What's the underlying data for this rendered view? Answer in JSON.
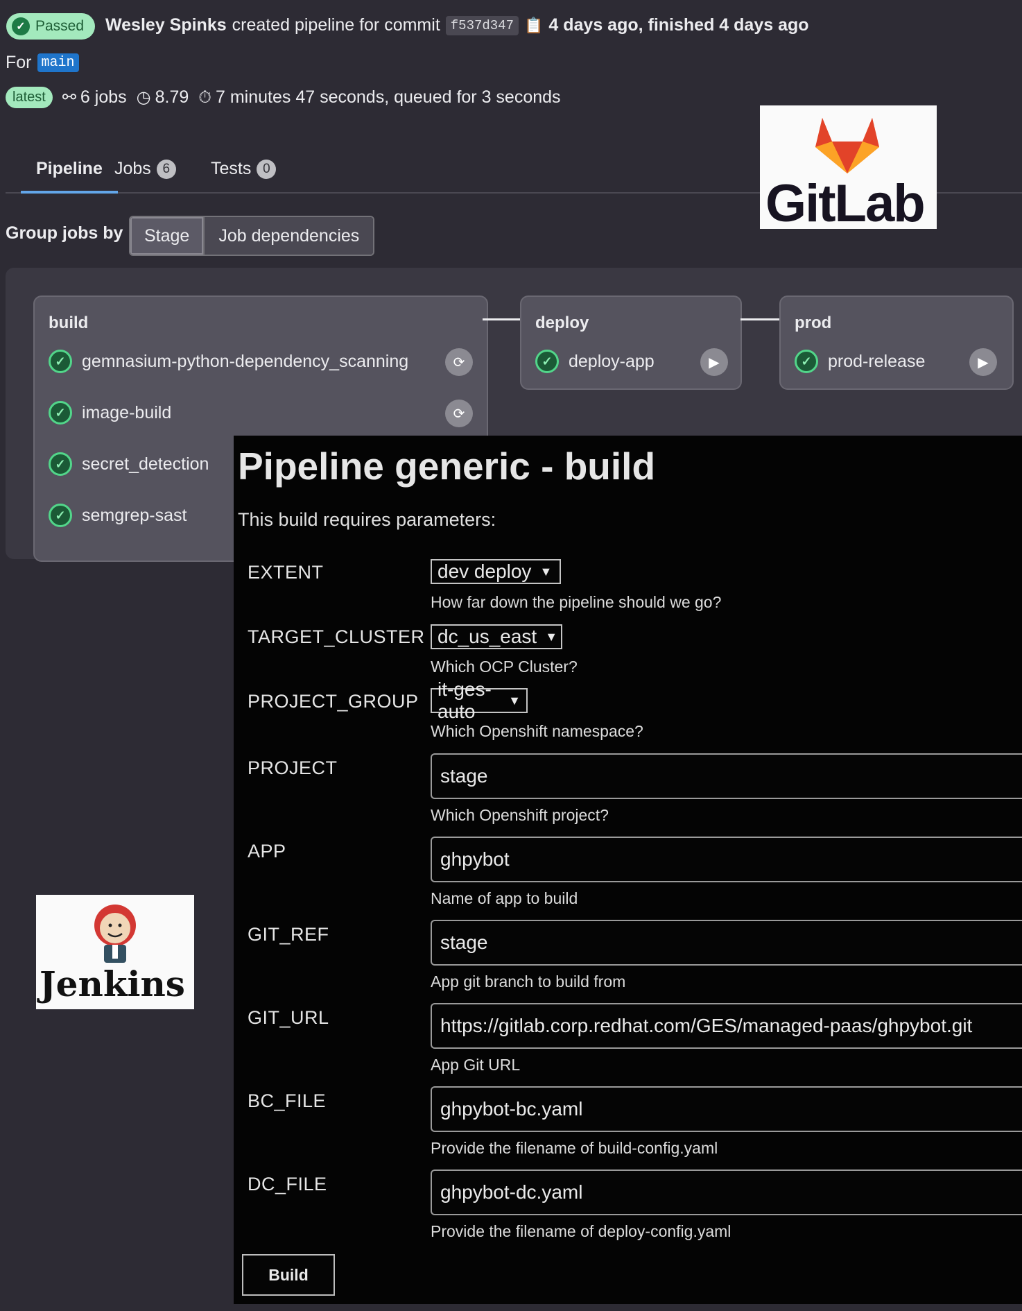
{
  "gitlab": {
    "status": "Passed",
    "author": "Wesley Spinks",
    "action_text": "created pipeline for commit",
    "commit_sha": "f537d347",
    "timing": "4 days ago, finished 4 days ago",
    "for_label": "For",
    "branch": "main",
    "latest_badge": "latest",
    "jobs_count": "6 jobs",
    "compute": "8.79",
    "duration": "7 minutes 47 seconds, queued for 3 seconds",
    "tabs": [
      {
        "label": "Pipeline",
        "count": ""
      },
      {
        "label": "Jobs",
        "count": "6"
      },
      {
        "label": "Tests",
        "count": "0"
      }
    ],
    "group_by_label": "Group jobs by",
    "group_by_options": [
      "Stage",
      "Job dependencies"
    ],
    "stages": [
      {
        "name": "build",
        "jobs": [
          "gemnasium-python-dependency_scanning",
          "image-build",
          "secret_detection",
          "semgrep-sast"
        ]
      },
      {
        "name": "deploy",
        "jobs": [
          "deploy-app"
        ]
      },
      {
        "name": "prod",
        "jobs": [
          "prod-release"
        ]
      }
    ],
    "logo_text": "GitLab",
    "logo_color": "#fc6d26"
  },
  "jenkins": {
    "logo_text": "Jenkins",
    "title": "Pipeline generic - build",
    "subtitle": "This build requires parameters:",
    "params": [
      {
        "name": "EXTENT",
        "value": "dev deploy",
        "desc": "How far down the pipeline should we go?"
      },
      {
        "name": "TARGET_CLUSTER",
        "value": "dc_us_east",
        "desc": "Which OCP Cluster?"
      },
      {
        "name": "PROJECT_GROUP",
        "value": "it-ges-auto",
        "desc": "Which Openshift namespace?"
      },
      {
        "name": "PROJECT",
        "value": "stage",
        "desc": "Which Openshift project?"
      },
      {
        "name": "APP",
        "value": "ghpybot",
        "desc": "Name of app to build"
      },
      {
        "name": "GIT_REF",
        "value": "stage",
        "desc": "App git branch to build from"
      },
      {
        "name": "GIT_URL",
        "value": "https://gitlab.corp.redhat.com/GES/managed-paas/ghpybot.git",
        "desc": "App Git URL"
      },
      {
        "name": "BC_FILE",
        "value": "ghpybot-bc.yaml",
        "desc": "Provide the filename of build-config.yaml"
      },
      {
        "name": "DC_FILE",
        "value": "ghpybot-dc.yaml",
        "desc": "Provide the filename of deploy-config.yaml"
      }
    ],
    "build_button": "Build"
  }
}
